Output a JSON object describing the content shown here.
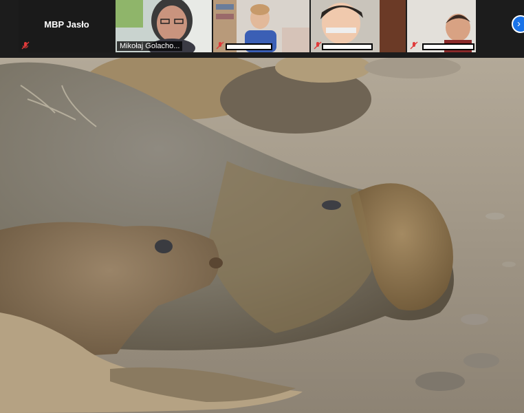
{
  "participants": [
    {
      "name": "MBP Jasło",
      "muted": true,
      "video": false
    },
    {
      "name": "Mikołaj Golacho...",
      "muted": false,
      "video": true,
      "active_speaker": true
    },
    {
      "name": "",
      "muted": true,
      "video": true,
      "redacted": true
    },
    {
      "name": "",
      "muted": true,
      "video": true,
      "redacted": true
    },
    {
      "name": "",
      "muted": true,
      "video": true,
      "redacted": true
    }
  ],
  "next_page_icon": "chevron-right-icon",
  "shared_content": {
    "description_type": "photo"
  },
  "colors": {
    "active_speaker_border": "#6fd14a",
    "nav_button": "#1a73e8"
  }
}
